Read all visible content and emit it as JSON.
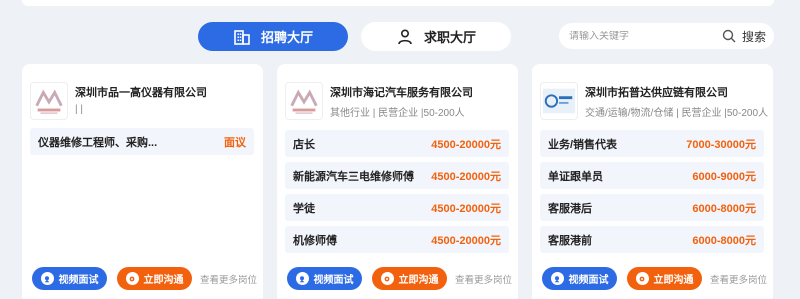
{
  "tabs": {
    "recruit_label": "招聘大厅",
    "jobseek_label": "求职大厅"
  },
  "search": {
    "placeholder": "请输入关键字",
    "button_label": "搜索"
  },
  "cards": [
    {
      "company": "深圳市品一高仪器有限公司",
      "meta": "| |",
      "jobs": [
        {
          "title": "仪器维修工程师、采购...",
          "salary": "面议"
        }
      ]
    },
    {
      "company": "深圳市海记汽车服务有限公司",
      "meta": "其他行业 | 民营企业 |50-200人",
      "jobs": [
        {
          "title": "店长",
          "salary": "4500-20000元"
        },
        {
          "title": "新能源汽车三电维修师傅",
          "salary": "4500-20000元"
        },
        {
          "title": "学徒",
          "salary": "4500-20000元"
        },
        {
          "title": "机修师傅",
          "salary": "4500-20000元"
        }
      ]
    },
    {
      "company": "深圳市拓普达供应链有限公司",
      "meta": "交通/运输/物流/仓储 | 民营企业 |50-200人",
      "jobs": [
        {
          "title": "业务/销售代表",
          "salary": "7000-30000元"
        },
        {
          "title": "单证跟单员",
          "salary": "6000-9000元"
        },
        {
          "title": "客服港后",
          "salary": "6000-8000元"
        },
        {
          "title": "客服港前",
          "salary": "6000-8000元"
        }
      ]
    }
  ],
  "actions": {
    "video_label": "视频面试",
    "chat_label": "立即沟通",
    "more_label": "查看更多岗位"
  },
  "colors": {
    "primary": "#2d6be4",
    "accent": "#f2620e"
  }
}
